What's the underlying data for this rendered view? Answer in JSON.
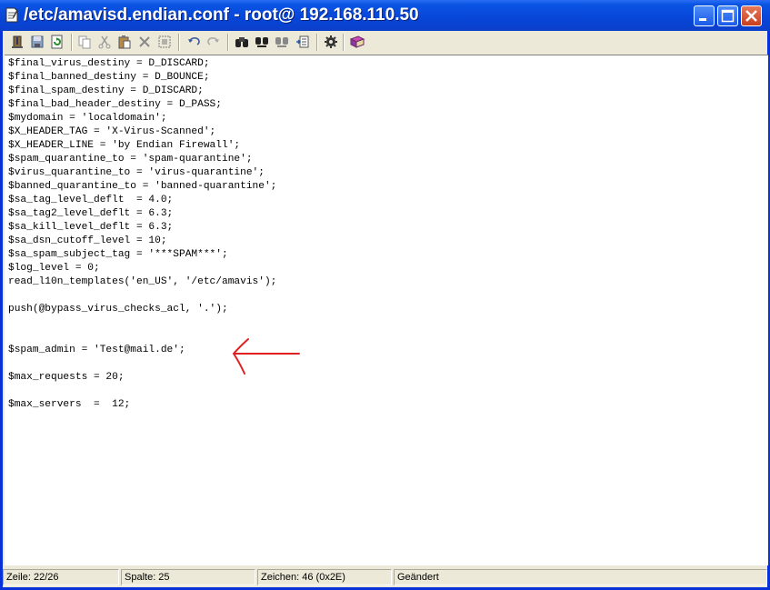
{
  "window": {
    "title": "/etc/amavisd.endian.conf - root@ 192.168.110.50"
  },
  "toolbar": {
    "buttons": [
      "exit-icon",
      "save-icon",
      "reload-icon",
      "copy-icon",
      "cut-icon",
      "paste-icon",
      "delete-icon",
      "select-all-icon",
      "undo-icon",
      "redo-icon",
      "find-icon",
      "find-next-icon",
      "find-prev-icon",
      "goto-icon",
      "settings-icon",
      "help-icon"
    ]
  },
  "editor": {
    "lines": [
      "$final_virus_destiny = D_DISCARD;",
      "$final_banned_destiny = D_BOUNCE;",
      "$final_spam_destiny = D_DISCARD;",
      "$final_bad_header_destiny = D_PASS;",
      "$mydomain = 'localdomain';",
      "$X_HEADER_TAG = 'X-Virus-Scanned';",
      "$X_HEADER_LINE = 'by Endian Firewall';",
      "$spam_quarantine_to = 'spam-quarantine';",
      "$virus_quarantine_to = 'virus-quarantine';",
      "$banned_quarantine_to = 'banned-quarantine';",
      "$sa_tag_level_deflt  = 4.0;",
      "$sa_tag2_level_deflt = 6.3;",
      "$sa_kill_level_deflt = 6.3;",
      "$sa_dsn_cutoff_level = 10;",
      "$sa_spam_subject_tag = '***SPAM***';",
      "$log_level = 0;",
      "read_l10n_templates('en_US', '/etc/amavis');",
      "",
      "push(@bypass_virus_checks_acl, '.');",
      "",
      "",
      "$spam_admin = 'Test@mail.de';",
      "",
      "$max_requests = 20;",
      "",
      "$max_servers  =  12;"
    ],
    "annotation_color": "#e02020"
  },
  "status": {
    "line": "Zeile: 22/26",
    "column": "Spalte: 25",
    "char": "Zeichen: 46 (0x2E)",
    "state": "Geändert"
  }
}
